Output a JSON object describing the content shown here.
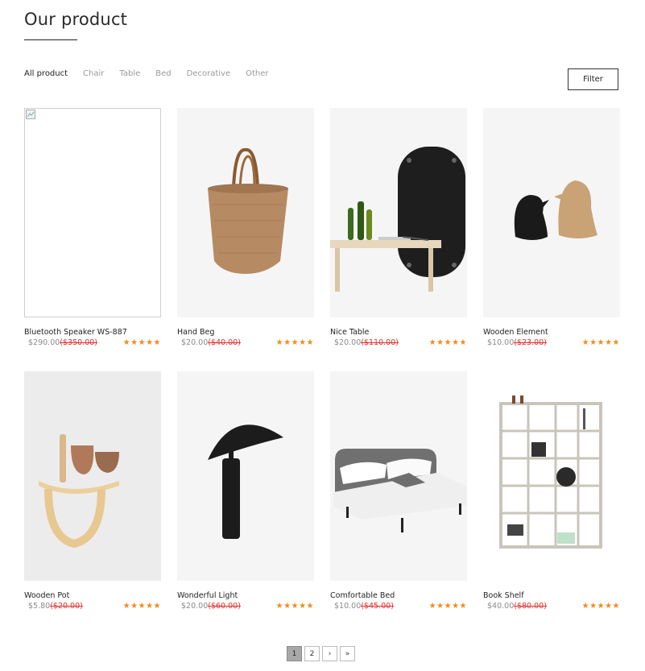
{
  "section": {
    "title": "Our product"
  },
  "tabs": [
    "All product",
    "Chair",
    "Table",
    "Bed",
    "Decorative",
    "Other"
  ],
  "filter_label": "Filter",
  "products": [
    {
      "name": "Bluetooth Speaker WS-887",
      "price": "$290.00",
      "old_price": "($350.00)",
      "rating": 5,
      "image": "broken-image"
    },
    {
      "name": "Hand Beg",
      "price": "$20.00",
      "old_price": "($40.00)",
      "rating": 5,
      "image": "woven-bag"
    },
    {
      "name": "Nice Table",
      "price": "$20.00",
      "old_price": "($110.00)",
      "rating": 5,
      "image": "bench-mirror-bottles"
    },
    {
      "name": "Wooden Element",
      "price": "$10.00",
      "old_price": "($23.00)",
      "rating": 5,
      "image": "bird-figurines"
    },
    {
      "name": "Wooden Pot",
      "price": "$5.80",
      "old_price": "($20.00)",
      "rating": 5,
      "image": "wall-shelf-pots"
    },
    {
      "name": "Wonderful Light",
      "price": "$20.00",
      "old_price": "($60.00)",
      "rating": 5,
      "image": "table-lamp"
    },
    {
      "name": "Comfortable Bed",
      "price": "$10.00",
      "old_price": "($45.00)",
      "rating": 5,
      "image": "bed"
    },
    {
      "name": "Book Shelf",
      "price": "$40.00",
      "old_price": "($80.00)",
      "rating": 5,
      "image": "bookshelf"
    }
  ],
  "pagination": {
    "pages": [
      "1",
      "2"
    ],
    "current": "1",
    "next": "›",
    "last": "»"
  },
  "colors": {
    "star": "#f28b1d",
    "old_price": "#e52e2e",
    "active_page": "#a8a8a8"
  }
}
